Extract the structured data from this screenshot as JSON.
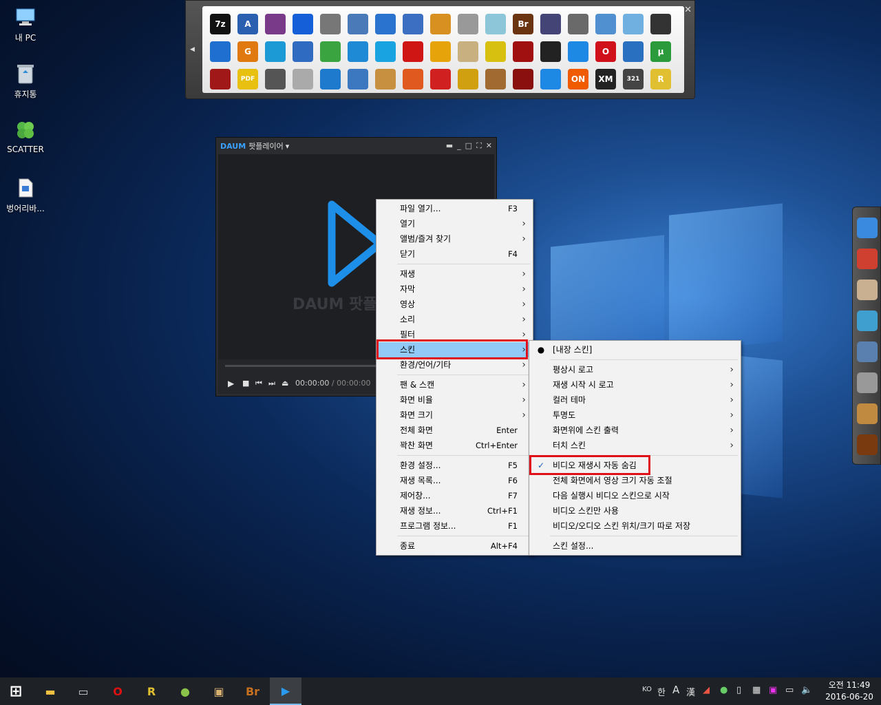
{
  "desktop": {
    "icons": [
      {
        "label": "내 PC",
        "icon": "computer-icon"
      },
      {
        "label": "휴지통",
        "icon": "recycle-bin-icon"
      },
      {
        "label": "SCATTER",
        "icon": "clover-icon"
      },
      {
        "label": "벙어리바...",
        "icon": "file-icon"
      }
    ]
  },
  "launcher": {
    "close_label": "✕",
    "rows": [
      [
        {
          "t": "7z",
          "c": "#111"
        },
        {
          "t": "A",
          "c": "#2b5fb0"
        },
        {
          "t": "",
          "c": "#7a3a8a"
        },
        {
          "t": "",
          "c": "#1560d8"
        },
        {
          "t": "",
          "c": "#777"
        },
        {
          "t": "",
          "c": "#4a7ab8"
        },
        {
          "t": "",
          "c": "#2a73cf"
        },
        {
          "t": "",
          "c": "#3c6fc2"
        },
        {
          "t": "",
          "c": "#d89020"
        },
        {
          "t": "",
          "c": "#999"
        },
        {
          "t": "",
          "c": "#8cc6d8"
        },
        {
          "t": "Br",
          "c": "#6a3410"
        },
        {
          "t": "",
          "c": "#447"
        },
        {
          "t": "",
          "c": "#6a6a6a"
        },
        {
          "t": "",
          "c": "#5090d0"
        },
        {
          "t": "",
          "c": "#70b0e0"
        },
        {
          "t": "",
          "c": "#333"
        }
      ],
      [
        {
          "t": "",
          "c": "#1e6fd0"
        },
        {
          "t": "G",
          "c": "#e07a10"
        },
        {
          "t": "",
          "c": "#1b9ad6"
        },
        {
          "t": "",
          "c": "#2f6bc0"
        },
        {
          "t": "",
          "c": "#3aa540"
        },
        {
          "t": "",
          "c": "#1e8ad6"
        },
        {
          "t": "",
          "c": "#19a3e0"
        },
        {
          "t": "",
          "c": "#d01515"
        },
        {
          "t": "",
          "c": "#e6a40a"
        },
        {
          "t": "",
          "c": "#c8b080"
        },
        {
          "t": "",
          "c": "#d8c010"
        },
        {
          "t": "",
          "c": "#a01010"
        },
        {
          "t": "",
          "c": "#222"
        },
        {
          "t": "",
          "c": "#1e88e5"
        },
        {
          "t": "O",
          "c": "#d0101a"
        },
        {
          "t": "",
          "c": "#2a70c0"
        },
        {
          "t": "µ",
          "c": "#2a9a3a"
        }
      ],
      [
        {
          "t": "",
          "c": "#a01818"
        },
        {
          "t": "PDF",
          "c": "#e8c010"
        },
        {
          "t": "",
          "c": "#555"
        },
        {
          "t": "",
          "c": "#aaa"
        },
        {
          "t": "",
          "c": "#1e7acc"
        },
        {
          "t": "",
          "c": "#3b78c0"
        },
        {
          "t": "",
          "c": "#c69040"
        },
        {
          "t": "",
          "c": "#e05a20"
        },
        {
          "t": "",
          "c": "#d02020"
        },
        {
          "t": "",
          "c": "#d0a010"
        },
        {
          "t": "",
          "c": "#a06a30"
        },
        {
          "t": "",
          "c": "#8a1010"
        },
        {
          "t": "",
          "c": "#1e88e5"
        },
        {
          "t": "ON",
          "c": "#f05a00"
        },
        {
          "t": "XM",
          "c": "#222"
        },
        {
          "t": "321",
          "c": "#444"
        },
        {
          "t": "R",
          "c": "#e0c030"
        }
      ]
    ]
  },
  "dock": {
    "items": [
      "disk-icon",
      "color-icon",
      "dvd-icon",
      "book-icon",
      "computer-icon",
      "drive-icon",
      "box-icon",
      "bridge-icon"
    ]
  },
  "player": {
    "title": "팟플레이어",
    "title_arrow": "▾",
    "logo": "DAUM",
    "watermark": "팟플",
    "controls": {
      "play": "▶",
      "stop": "■",
      "prev": "⏮",
      "next": "⏭",
      "eject": "⏏"
    },
    "time_current": "00:00:00",
    "time_separator": " / ",
    "time_total": "00:00:00"
  },
  "main_menu": {
    "items": [
      {
        "label": "파일 열기...",
        "shortcut": "F3"
      },
      {
        "label": "열기",
        "arrow": true
      },
      {
        "label": "앨범/즐겨 찾기",
        "arrow": true
      },
      {
        "label": "닫기",
        "shortcut": "F4"
      },
      {
        "sep": true
      },
      {
        "label": "재생",
        "arrow": true
      },
      {
        "label": "자막",
        "arrow": true
      },
      {
        "label": "영상",
        "arrow": true
      },
      {
        "label": "소리",
        "arrow": true
      },
      {
        "label": "필터",
        "arrow": true
      },
      {
        "label": "스킨",
        "arrow": true,
        "highlight": true
      },
      {
        "label": "환경/언어/기타",
        "arrow": true
      },
      {
        "sep": true
      },
      {
        "label": "팬 & 스캔",
        "arrow": true
      },
      {
        "label": "화면 비율",
        "arrow": true
      },
      {
        "label": "화면 크기",
        "arrow": true
      },
      {
        "label": "전체 화면",
        "shortcut": "Enter"
      },
      {
        "label": "꽉찬 화면",
        "shortcut": "Ctrl+Enter"
      },
      {
        "sep": true
      },
      {
        "label": "환경 설정...",
        "shortcut": "F5"
      },
      {
        "label": "재생 목록...",
        "shortcut": "F6"
      },
      {
        "label": "제어창...",
        "shortcut": "F7"
      },
      {
        "label": "재생 정보...",
        "shortcut": "Ctrl+F1"
      },
      {
        "label": "프로그램 정보...",
        "shortcut": "F1"
      },
      {
        "sep": true
      },
      {
        "label": "종료",
        "shortcut": "Alt+F4"
      }
    ]
  },
  "skin_menu": {
    "items": [
      {
        "label": "[내장 스킨]",
        "mark": "●"
      },
      {
        "sep": true
      },
      {
        "label": "평상시 로고",
        "arrow": true
      },
      {
        "label": "재생 시작 시 로고",
        "arrow": true
      },
      {
        "label": "컬러 테마",
        "arrow": true
      },
      {
        "label": "투명도",
        "arrow": true
      },
      {
        "label": "화면위에 스킨 출력",
        "arrow": true
      },
      {
        "label": "터치 스킨",
        "arrow": true
      },
      {
        "sep": true
      },
      {
        "label": "비디오 재생시 자동 숨김",
        "mark": "✓"
      },
      {
        "label": "전체 화면에서 영상 크기 자동 조절"
      },
      {
        "label": "다음 실행시 비디오 스킨으로 시작"
      },
      {
        "label": "비디오 스킨만 사용"
      },
      {
        "label": "비디오/오디오 스킨 위치/크기 따로 저장"
      },
      {
        "sep": true
      },
      {
        "label": "스킨 설정..."
      }
    ]
  },
  "taskbar": {
    "pinned": [
      "start-icon",
      "file-explorer-icon",
      "cmd-icon",
      "opera-icon",
      "r-icon",
      "olive-icon",
      "box-icon",
      "bridge-icon",
      "potplayer-icon"
    ],
    "tray": {
      "lang": "KO",
      "ime1": "한",
      "ime2": "A",
      "ime3": "漢"
    },
    "time": "오전 11:49",
    "date": "2016-06-20"
  }
}
